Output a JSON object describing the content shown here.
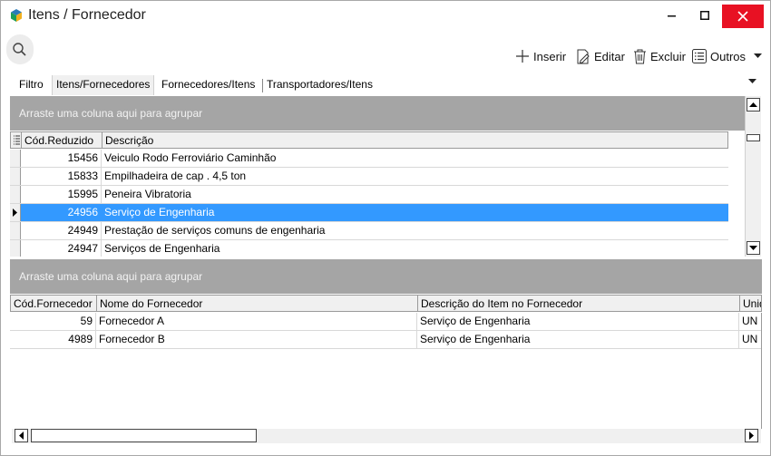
{
  "window": {
    "title": "Itens / Fornecedor"
  },
  "toolbar": {
    "inserir": "Inserir",
    "editar": "Editar",
    "excluir": "Excluir",
    "outros": "Outros"
  },
  "tabs": [
    {
      "label": "Filtro",
      "active": false
    },
    {
      "label": "Itens/Fornecedores",
      "active": true
    },
    {
      "label": "Fornecedores/Itens",
      "active": false
    },
    {
      "label": "Transportadores/Itens",
      "active": false
    }
  ],
  "items_grid": {
    "group_hint": "Arraste uma coluna aqui para agrupar",
    "columns": [
      "Cód.Reduzido",
      "Descrição"
    ],
    "rows": [
      {
        "code": "15456",
        "desc": "Veiculo Rodo Ferroviário Caminhão",
        "selected": false
      },
      {
        "code": "15833",
        "desc": "Empilhadeira de  cap . 4,5 ton",
        "selected": false
      },
      {
        "code": "15995",
        "desc": "Peneira Vibratoria",
        "selected": false
      },
      {
        "code": "24956",
        "desc": "Serviço de Engenharia",
        "selected": true
      },
      {
        "code": "24949",
        "desc": "Prestação de serviços comuns de engenharia",
        "selected": false
      },
      {
        "code": "24947",
        "desc": "Serviços de Engenharia",
        "selected": false
      }
    ]
  },
  "suppliers_grid": {
    "group_hint": "Arraste uma coluna aqui para agrupar",
    "columns": [
      "Cód.Fornecedor",
      "Nome do Fornecedor",
      "Descrição do Item no Fornecedor",
      "Unid"
    ],
    "rows": [
      {
        "code": "59",
        "name": "Fornecedor A",
        "desc": "Serviço de Engenharia",
        "unit": "UN"
      },
      {
        "code": "4989",
        "name": "Fornecedor B",
        "desc": "Serviço de Engenharia",
        "unit": "UN"
      }
    ]
  },
  "colors": {
    "selection": "#3399ff",
    "group_panel": "#a5a5a5",
    "close_button": "#e81123"
  }
}
